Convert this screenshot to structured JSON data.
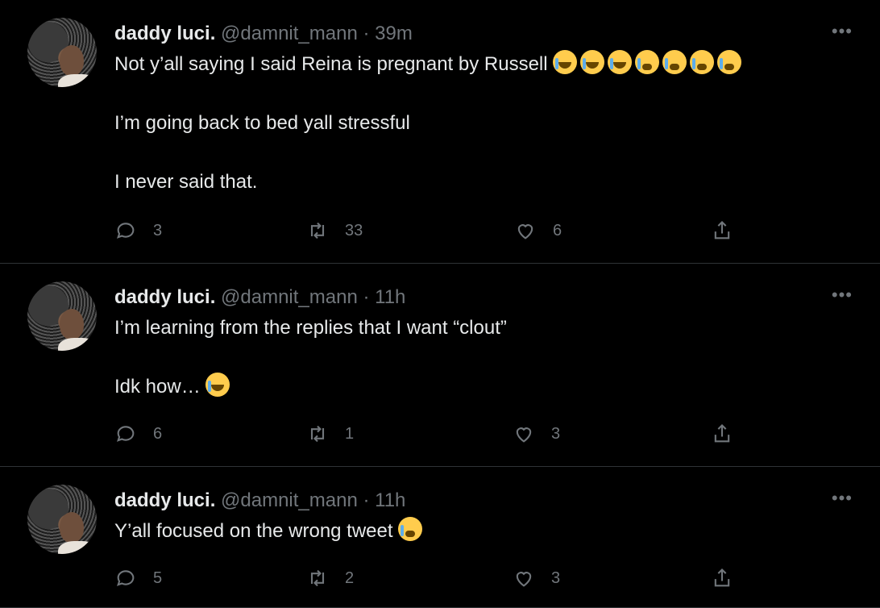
{
  "tweets": [
    {
      "name": "daddy luci.",
      "handle": "@damnit_mann",
      "time": "· 39m",
      "more_label": "•••",
      "lines": [
        "Not y’all saying I said Reina is pregnant by Russell",
        "I’m going back to bed yall stressful",
        "I never said that."
      ],
      "emojis": [
        "joy",
        "joy",
        "joy",
        "cry",
        "cry",
        "cry",
        "cry"
      ],
      "replies": "3",
      "retweets": "33",
      "likes": "6"
    },
    {
      "name": "daddy luci.",
      "handle": "@damnit_mann",
      "time": "· 11h",
      "more_label": "•••",
      "lines": [
        "I’m learning from the replies that I want “clout”",
        "Idk how…"
      ],
      "emojis": [
        "joy"
      ],
      "replies": "6",
      "retweets": "1",
      "likes": "3"
    },
    {
      "name": "daddy luci.",
      "handle": "@damnit_mann",
      "time": "· 11h",
      "more_label": "•••",
      "lines": [
        "Y’all focused on the wrong tweet"
      ],
      "emojis": [
        "cry"
      ],
      "replies": "5",
      "retweets": "2",
      "likes": "3"
    }
  ],
  "colors": {
    "background": "#000000",
    "text": "#e7e9ea",
    "muted": "#71767b",
    "divider": "#2f3336"
  }
}
